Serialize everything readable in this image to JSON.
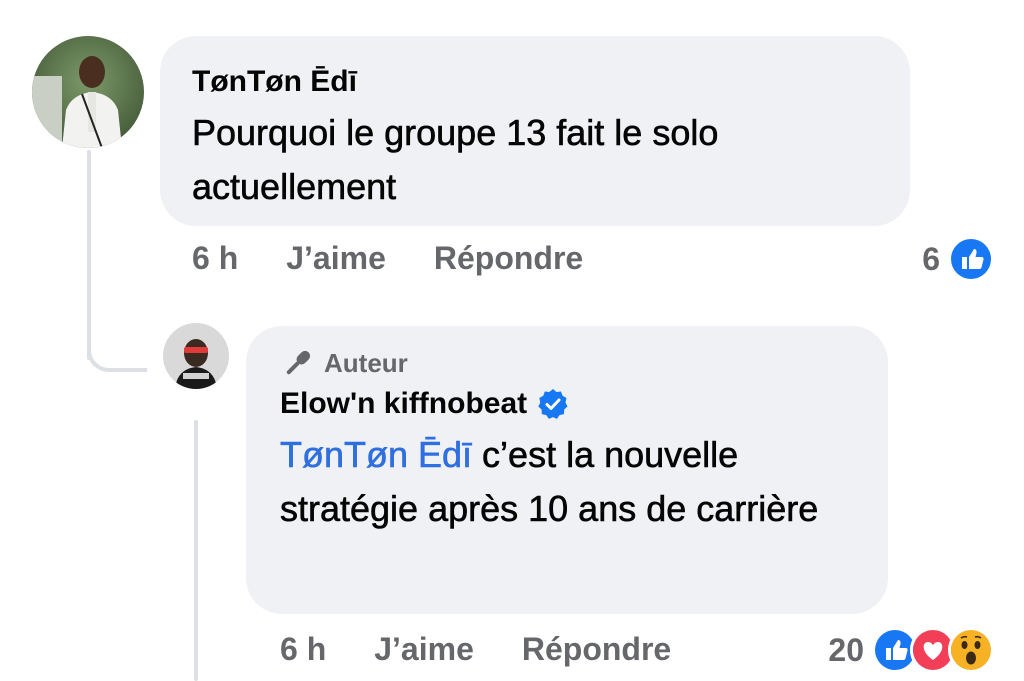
{
  "comment": {
    "author": "TønTøn Ēdī",
    "text": "Pourquoi le groupe 13 fait le solo actuellement",
    "time": "6 h",
    "like_label": "J’aime",
    "reply_label": "Répondre",
    "reaction_count": "6",
    "reactions": [
      "like-icon"
    ]
  },
  "reply": {
    "badge": "Auteur",
    "author": "Elow'n kiffnobeat",
    "verified": true,
    "mention": "TønTøn Ēdī",
    "text": " c’est la nouvelle stratégie après 10 ans de carrière",
    "time": "6 h",
    "like_label": "J’aime",
    "reply_label": "Répondre",
    "reaction_count": "20",
    "reactions": [
      "like-icon",
      "love-icon",
      "wow-icon"
    ]
  },
  "colors": {
    "bubble": "#eff1f4",
    "link": "#2f6fe0",
    "secondary_text": "#65676b",
    "like_blue": "#1877f2",
    "love_red": "#f33e58",
    "wow_yellow": "#f7b125"
  }
}
